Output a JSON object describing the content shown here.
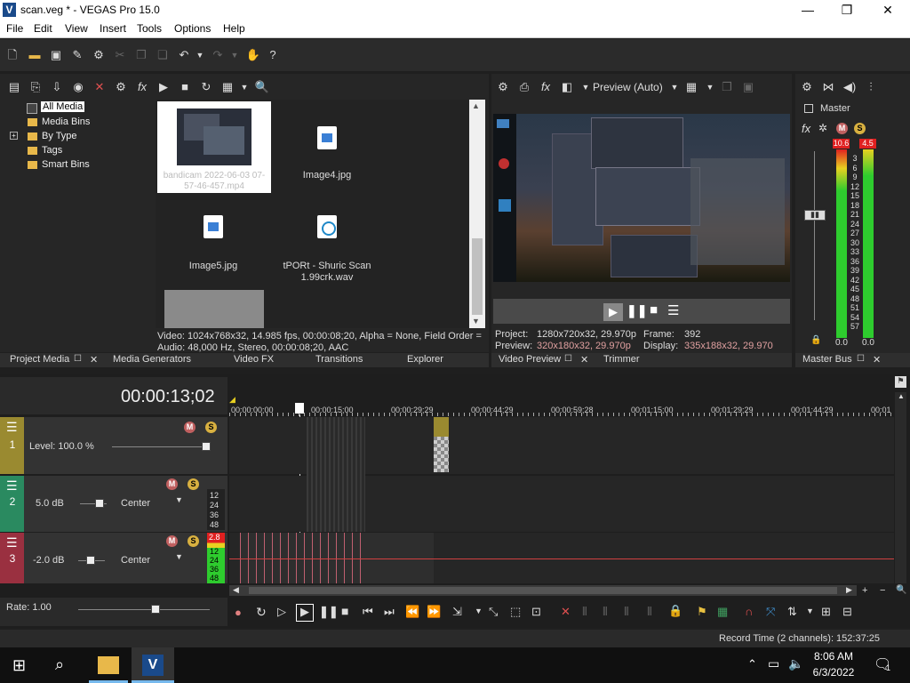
{
  "window": {
    "title": "scan.veg * - VEGAS Pro 15.0",
    "app_icon": "V",
    "minimize": "—",
    "maximize": "❐",
    "close": "✕"
  },
  "menu": [
    "File",
    "Edit",
    "View",
    "Insert",
    "Tools",
    "Options",
    "Help"
  ],
  "media_tree": [
    "All Media",
    "Media Bins",
    "By Type",
    "Tags",
    "Smart Bins"
  ],
  "media_files": {
    "video_name": "bandicam 2022-06-03 07-57-46-457.mp4",
    "img4": "Image4.jpg",
    "img5": "Image5.jpg",
    "wav": "tPORt - Shuric Scan 1.99crk.wav"
  },
  "media_info": {
    "video": "Video: 1024x768x32, 14.985 fps, 00:00:08;20, Alpha = None, Field Order =",
    "audio": "Audio: 48,000 Hz, Stereo, 00:00:08;20, AAC"
  },
  "left_tabs": [
    "Project Media",
    "Media Generators",
    "Video FX",
    "Transitions",
    "Explorer"
  ],
  "preview": {
    "mode": "Preview (Auto)",
    "project_label": "Project:",
    "project_value": "1280x720x32, 29.970p",
    "preview_label": "Preview:",
    "preview_value": "320x180x32, 29.970p",
    "frame_label": "Frame:",
    "frame_value": "392",
    "display_label": "Display:",
    "display_value": "335x188x32, 29.970"
  },
  "preview_tabs": [
    "Video Preview",
    "Trimmer"
  ],
  "master": {
    "label": "Master",
    "tab": "Master Bus",
    "peak_left": "10.6",
    "peak_right": "4.5",
    "bottom_left": "0.0",
    "bottom_right": "0.0",
    "scale": [
      "3",
      "6",
      "9",
      "12",
      "15",
      "18",
      "21",
      "24",
      "27",
      "30",
      "33",
      "36",
      "39",
      "42",
      "45",
      "48",
      "51",
      "54",
      "57"
    ]
  },
  "timeline": {
    "timecode": "00:00:13;02",
    "ruler": [
      "00:00:00;00",
      "00:00:15;00",
      "00:00:29;29",
      "00:00:44;29",
      "00:00:59;28",
      "00:01:15;00",
      "00:01:29;29",
      "00:01:44;29",
      "00:01"
    ]
  },
  "tracks": [
    {
      "num": "1",
      "label": "Level: 100.0 %",
      "color": "#9a8a30"
    },
    {
      "num": "2",
      "label": "5.0 dB",
      "pan": "Center",
      "color": "#2a8a60",
      "meter_scale": [
        "12",
        "24",
        "36",
        "48"
      ]
    },
    {
      "num": "3",
      "label": "-2.0 dB",
      "pan": "Center",
      "color": "#9a3040",
      "peak": "2.8",
      "meter_scale": [
        "12",
        "24",
        "36",
        "48"
      ]
    }
  ],
  "rate": "Rate: 1.00",
  "status": "Record Time (2 channels): 152:37:25",
  "taskbar": {
    "time": "8:06 AM",
    "date": "6/3/2022",
    "notif": "1"
  },
  "colors": {
    "accent": "#1a4a8a",
    "meter_green": "#2ecc2e",
    "meter_yellow": "#e8d020",
    "meter_red": "#e02020",
    "cursor_red": "#d04040",
    "pink_text": "#e0a0a0"
  }
}
